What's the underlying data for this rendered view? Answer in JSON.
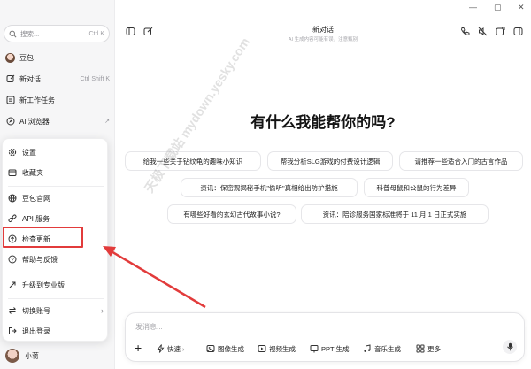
{
  "sidebar": {
    "search_placeholder": "搜索...",
    "search_shortcut": "Ctrl K",
    "items": [
      {
        "label": "豆包",
        "shortcut": ""
      },
      {
        "label": "新对话",
        "shortcut": "Ctrl Shift K"
      },
      {
        "label": "新工作任务",
        "shortcut": ""
      },
      {
        "label": "AI 浏览器",
        "shortcut": "↗"
      }
    ]
  },
  "menu": {
    "items": [
      {
        "label": "设置"
      },
      {
        "label": "收藏夹"
      },
      {
        "label": "豆包官网"
      },
      {
        "label": "API 服务"
      },
      {
        "label": "检查更新"
      },
      {
        "label": "帮助与反馈"
      },
      {
        "label": "升级到专业版"
      },
      {
        "label": "切换账号",
        "chevron": "›"
      },
      {
        "label": "退出登录"
      }
    ]
  },
  "user": {
    "name": "小蒋"
  },
  "header": {
    "title": "新对话",
    "subtitle": "AI 生成内容可能有误，注意甄别",
    "window_controls": [
      "—",
      "▢",
      "✕"
    ]
  },
  "main": {
    "heading": "有什么我能帮你的吗?",
    "suggestions": [
      "给我一些关于钻纹龟的趣味小知识",
      "帮我分析SLG游戏的付费设计逻辑",
      "请推荐一些适合入门的古言作品",
      "资讯：保密观揭秘手机\"偷听\"真相给出防护措施",
      "科普母鼠和公鼠的行为差异",
      "有哪些好看的玄幻古代故事小说?",
      "资讯：陪诊服务国家标准将于 11 月 1 日正式实施"
    ]
  },
  "composer": {
    "placeholder": "发消息...",
    "plus": "+",
    "tools": [
      {
        "label": "快速",
        "chevron": "›"
      },
      {
        "label": "图像生成"
      },
      {
        "label": "视频生成"
      },
      {
        "label": "PPT 生成"
      },
      {
        "label": "音乐生成"
      },
      {
        "label": "更多"
      }
    ]
  },
  "watermark": "天极下载站 mydown.yesky.com",
  "colors": {
    "highlight": "#e23b3b",
    "sidebar_bg": "#f6f6f7"
  }
}
